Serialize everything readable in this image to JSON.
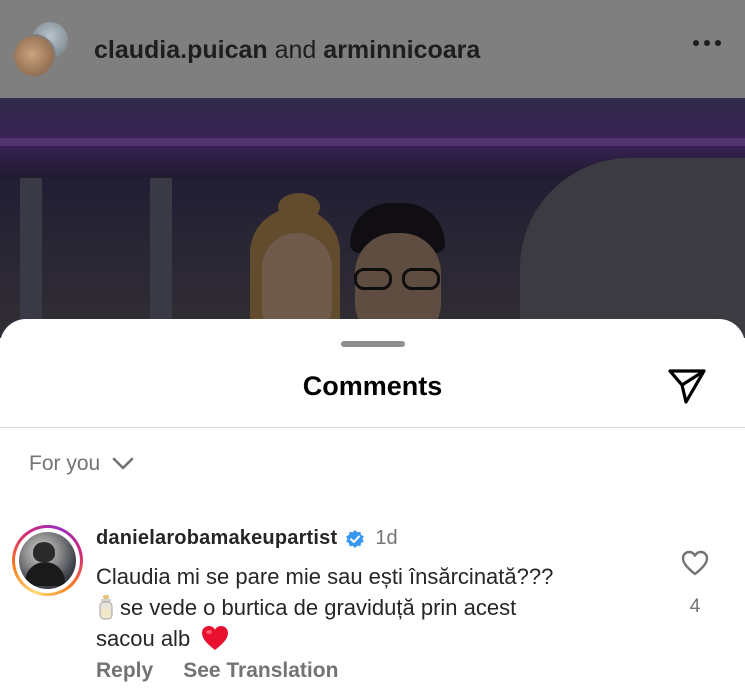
{
  "post": {
    "user1": "claudia.puican",
    "joiner": "and",
    "user2": "arminnicoara",
    "more_icon": "more-horizontal-icon"
  },
  "sheet": {
    "title": "Comments",
    "share_icon": "send-icon",
    "filter_label": "For you",
    "filter_icon": "chevron-down-icon"
  },
  "comment": {
    "username": "danielarobamakeupartist",
    "verified_icon": "verified-badge-icon",
    "time": "1d",
    "line1": "Claudia mi se pare mie sau ești însărcinată???",
    "line2": "se vede o burtica de graviduță prin acest",
    "line3": "sacou alb",
    "reply_label": "Reply",
    "translation_label": "See Translation",
    "like_icon": "heart-outline-icon",
    "like_count": "4"
  },
  "colors": {
    "accent_verified": "#3897f0",
    "heart_red": "#e8102e",
    "secondary_text": "#737373"
  }
}
